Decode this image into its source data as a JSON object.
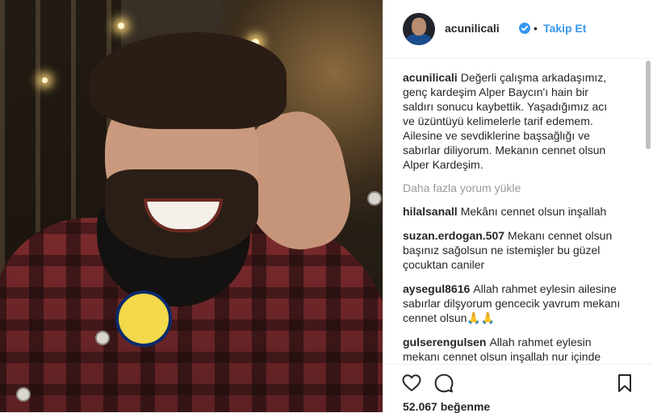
{
  "header": {
    "username": "acunilicali",
    "separator": "•",
    "follow_label": "Takip Et",
    "verified": true,
    "icons": {
      "avatar": "profile-avatar",
      "verified": "verified-badge-icon"
    }
  },
  "caption": {
    "author": "acunilicali",
    "text": "Değerli çalışma arkadaşımız, genç kardeşim Alper Baycın'ı hain bir saldırı sonucu kaybettik. Yaşadığımız acı ve üzüntüyü kelimelerle tarif edemem. Ailesine ve sevdiklerine başsağlığı ve sabırlar diliyorum. Mekanın cennet olsun Alper Kardeşim."
  },
  "load_more_label": "Daha fazla yorum yükle",
  "comments": [
    {
      "author": "hilalsanall",
      "text": "Mekânı cennet olsun inşallah"
    },
    {
      "author": "suzan.erdogan.507",
      "text": "Mekanı cennet olsun başınız sağolsun ne istemişler bu güzel çocuktan caniler"
    },
    {
      "author": "aysegul8616",
      "text": "Allah rahmet eylesin ailesine sabırlar dilşyorum gencecik yavrum mekanı cennet olsun🙏🙏"
    },
    {
      "author": "gulserengulsen",
      "text": "Allah rahmet eylesin mekanı cennet olsun inşallah nur içinde yatsın ailesine ve sevenlerine sabır versin"
    }
  ],
  "actions": {
    "icons": [
      "heart-icon",
      "comment-icon",
      "bookmark-icon"
    ]
  },
  "likes_label": "52.067 beğenme",
  "colors": {
    "link_blue": "#3897f0",
    "text": "#262626",
    "muted": "#999999",
    "border": "#efefef"
  }
}
